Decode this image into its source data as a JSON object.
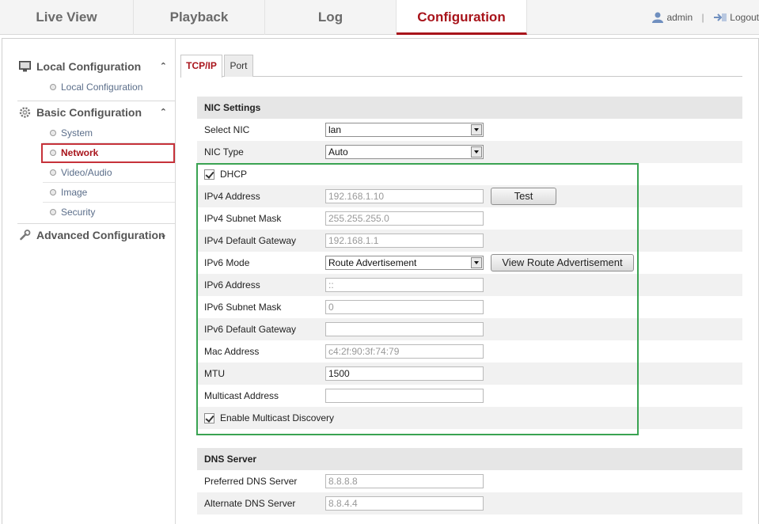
{
  "nav": {
    "tabs": [
      "Live View",
      "Playback",
      "Log",
      "Configuration"
    ],
    "active": "Configuration",
    "user": "admin",
    "logout": "Logout"
  },
  "sidebar": {
    "local": {
      "title": "Local Configuration",
      "items": [
        "Local Configuration"
      ]
    },
    "basic": {
      "title": "Basic Configuration",
      "items": [
        "System",
        "Network",
        "Video/Audio",
        "Image",
        "Security"
      ]
    },
    "advanced": {
      "title": "Advanced Configuration"
    },
    "active_item": "Network"
  },
  "content_tabs": [
    "TCP/IP",
    "Port"
  ],
  "nic": {
    "heading": "NIC Settings",
    "select_nic_label": "Select NIC",
    "select_nic_value": "lan",
    "nic_type_label": "NIC Type",
    "nic_type_value": "Auto",
    "dhcp_label": "DHCP",
    "dhcp_checked": true,
    "ipv4_address_label": "IPv4 Address",
    "ipv4_address_value": "192.168.1.10",
    "test_button": "Test",
    "ipv4_mask_label": "IPv4 Subnet Mask",
    "ipv4_mask_value": "255.255.255.0",
    "ipv4_gateway_label": "IPv4 Default Gateway",
    "ipv4_gateway_value": "192.168.1.1",
    "ipv6_mode_label": "IPv6 Mode",
    "ipv6_mode_value": "Route Advertisement",
    "view_route_button": "View Route Advertisement",
    "ipv6_address_label": "IPv6 Address",
    "ipv6_address_value": "::",
    "ipv6_mask_label": "IPv6 Subnet Mask",
    "ipv6_mask_value": "0",
    "ipv6_gateway_label": "IPv6 Default Gateway",
    "ipv6_gateway_value": "",
    "mac_label": "Mac Address",
    "mac_value": "c4:2f:90:3f:74:79",
    "mtu_label": "MTU",
    "mtu_value": "1500",
    "multicast_label": "Multicast Address",
    "multicast_value": "",
    "multicast_discovery_label": "Enable Multicast Discovery",
    "multicast_discovery_checked": true
  },
  "dns": {
    "heading": "DNS Server",
    "preferred_label": "Preferred DNS Server",
    "preferred_value": "8.8.8.8",
    "alternate_label": "Alternate DNS Server",
    "alternate_value": "8.8.4.4"
  },
  "colors": {
    "accent": "#a8141b",
    "highlight_box": "#3aa352"
  }
}
